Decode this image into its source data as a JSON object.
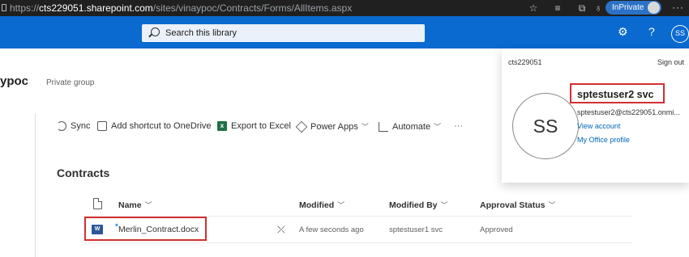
{
  "browser": {
    "url_scheme": "https://",
    "url_host": "cts229051.sharepoint.com",
    "url_path": "/sites/vinaypoc/Contracts/Forms/AllItems.aspx",
    "inprivate_label": "InPrivate",
    "more_label": "···"
  },
  "suitebar": {
    "search_placeholder": "Search this library",
    "help_label": "?",
    "avatar_initials": "SS",
    "color": "#0a6ad0"
  },
  "site": {
    "name": "ypoc",
    "visibility": "Private group"
  },
  "commandbar": {
    "sync": "Sync",
    "add_shortcut": "Add shortcut to OneDrive",
    "export": "Export to Excel",
    "power_apps": "Power Apps",
    "automate": "Automate",
    "overflow": "···"
  },
  "library": {
    "title": "Contracts",
    "columns": {
      "name": "Name",
      "modified": "Modified",
      "modified_by": "Modified By",
      "approval_status": "Approval Status"
    },
    "rows": [
      {
        "name": "Merlin_Contract.docx",
        "modified": "A few seconds ago",
        "modified_by": "sptestuser1 svc",
        "approval_status": "Approved",
        "file_type": "word-doc-icon"
      }
    ]
  },
  "account": {
    "tenant": "cts229051",
    "sign_out": "Sign out",
    "initials": "SS",
    "display_name": "sptestuser2 svc",
    "email": "sptestuser2@cts229051.onmi...",
    "view_account": "View account",
    "office_profile": "My Office profile"
  },
  "highlight_color": "#d32f2f"
}
